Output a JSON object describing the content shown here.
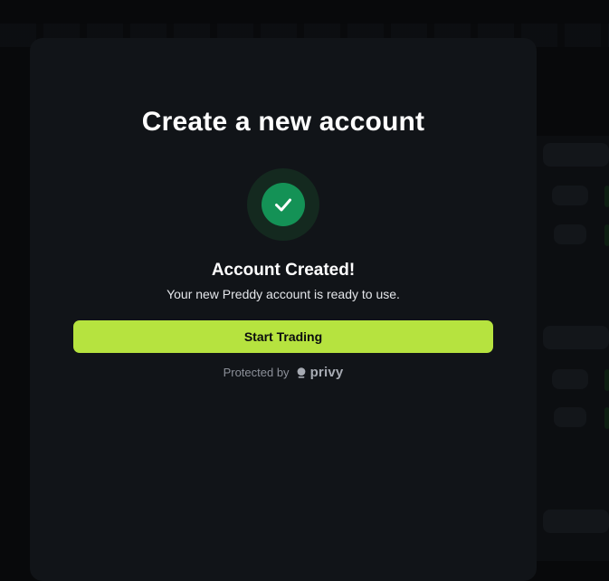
{
  "modal": {
    "title": "Create a new account",
    "status_title": "Account Created!",
    "status_message": "Your new Preddy account is ready to use.",
    "primary_button_label": "Start Trading",
    "protected_label": "Protected by",
    "provider_name": "privy"
  },
  "icons": {
    "status": "check-icon",
    "provider": "privy-logo-icon"
  },
  "colors": {
    "modal_background": "#111418",
    "backdrop": "#08090b",
    "success": "#149256",
    "accent_button": "#b6e33f"
  }
}
